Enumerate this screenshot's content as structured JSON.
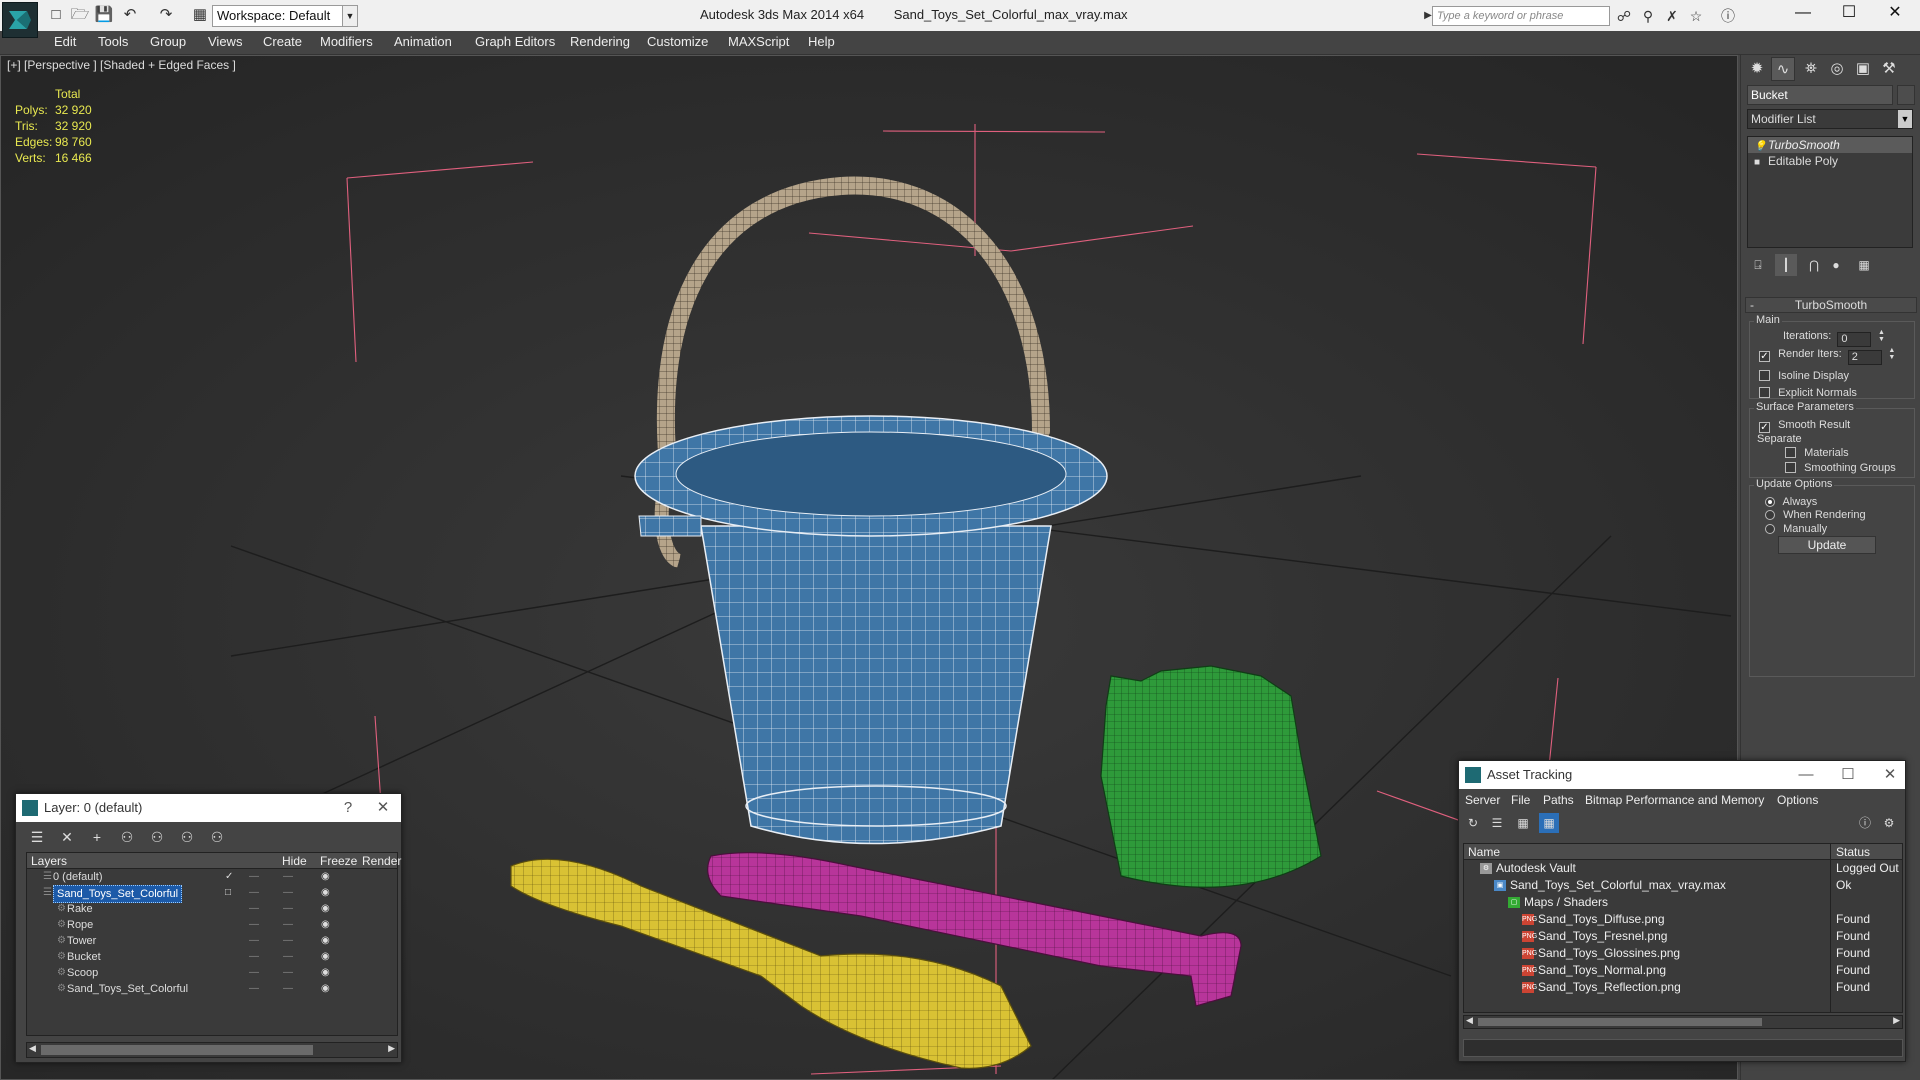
{
  "titlebar": {
    "workspace": "Workspace: Default",
    "app_title": "Autodesk 3ds Max  2014 x64",
    "file_name": "Sand_Toys_Set_Colorful_max_vray.max",
    "search_placeholder": "Type a keyword or phrase"
  },
  "menu": [
    "Edit",
    "Tools",
    "Group",
    "Views",
    "Create",
    "Modifiers",
    "Animation",
    "Graph Editors",
    "Rendering",
    "Customize",
    "MAXScript",
    "Help"
  ],
  "viewport": {
    "label": "[+] [Perspective ] [Shaded + Edged Faces ]",
    "stats": {
      "header": "Total",
      "rows": [
        {
          "k": "Polys:",
          "v": "32 920"
        },
        {
          "k": "Tris:",
          "v": "32 920"
        },
        {
          "k": "Edges:",
          "v": "98 760"
        },
        {
          "k": "Verts:",
          "v": "16 466"
        }
      ]
    },
    "colors": {
      "bucket": "#3f76a6",
      "handle": "#b5a48a",
      "tower": "#2e9a3a",
      "scoop": "#d9c234",
      "rake": "#b8359a",
      "bbox": "#e0607e",
      "grid": "#1e1e1e"
    }
  },
  "command_panel": {
    "object_name": "Bucket",
    "modifier_list": "Modifier List",
    "stack": [
      {
        "label": "TurboSmooth",
        "selected": true
      },
      {
        "label": "Editable Poly",
        "selected": false
      }
    ],
    "rollout_title": "TurboSmooth",
    "main": {
      "title": "Main",
      "iterations_label": "Iterations:",
      "iterations_value": "0",
      "render_iters_label": "Render Iters:",
      "render_iters_value": "2",
      "isoline": "Isoline Display",
      "explicit": "Explicit Normals"
    },
    "surface": {
      "title": "Surface Parameters",
      "smooth_result": "Smooth Result",
      "separate": "Separate",
      "materials": "Materials",
      "smoothing_groups": "Smoothing Groups"
    },
    "update": {
      "title": "Update Options",
      "always": "Always",
      "when_rendering": "When Rendering",
      "manually": "Manually",
      "button": "Update"
    }
  },
  "layer_window": {
    "title": "Layer: 0 (default)",
    "help": "?",
    "columns": [
      "Layers",
      "Hide",
      "Freeze",
      "Render"
    ],
    "rows": [
      {
        "name": "0 (default)",
        "indent": 0,
        "checked": true,
        "selected": false
      },
      {
        "name": "Sand_Toys_Set_Colorful",
        "indent": 0,
        "checked": false,
        "selected": true
      },
      {
        "name": "Rake",
        "indent": 1,
        "checked": false,
        "selected": false
      },
      {
        "name": "Rope",
        "indent": 1,
        "checked": false,
        "selected": false
      },
      {
        "name": "Tower",
        "indent": 1,
        "checked": false,
        "selected": false
      },
      {
        "name": "Bucket",
        "indent": 1,
        "checked": false,
        "selected": false
      },
      {
        "name": "Scoop",
        "indent": 1,
        "checked": false,
        "selected": false
      },
      {
        "name": "Sand_Toys_Set_Colorful",
        "indent": 1,
        "checked": false,
        "selected": false
      }
    ]
  },
  "asset_window": {
    "title": "Asset Tracking",
    "menu": [
      "Server",
      "File",
      "Paths",
      "Bitmap Performance and Memory",
      "Options"
    ],
    "columns": [
      "Name",
      "Status"
    ],
    "rows": [
      {
        "name": "Autodesk Vault",
        "status": "Logged Out",
        "indent": 0,
        "type": "vault"
      },
      {
        "name": "Sand_Toys_Set_Colorful_max_vray.max",
        "status": "Ok",
        "indent": 1,
        "type": "max"
      },
      {
        "name": "Maps / Shaders",
        "status": "",
        "indent": 2,
        "type": "folder"
      },
      {
        "name": "Sand_Toys_Diffuse.png",
        "status": "Found",
        "indent": 3,
        "type": "png"
      },
      {
        "name": "Sand_Toys_Fresnel.png",
        "status": "Found",
        "indent": 3,
        "type": "png"
      },
      {
        "name": "Sand_Toys_Glossines.png",
        "status": "Found",
        "indent": 3,
        "type": "png"
      },
      {
        "name": "Sand_Toys_Normal.png",
        "status": "Found",
        "indent": 3,
        "type": "png"
      },
      {
        "name": "Sand_Toys_Reflection.png",
        "status": "Found",
        "indent": 3,
        "type": "png"
      }
    ]
  }
}
